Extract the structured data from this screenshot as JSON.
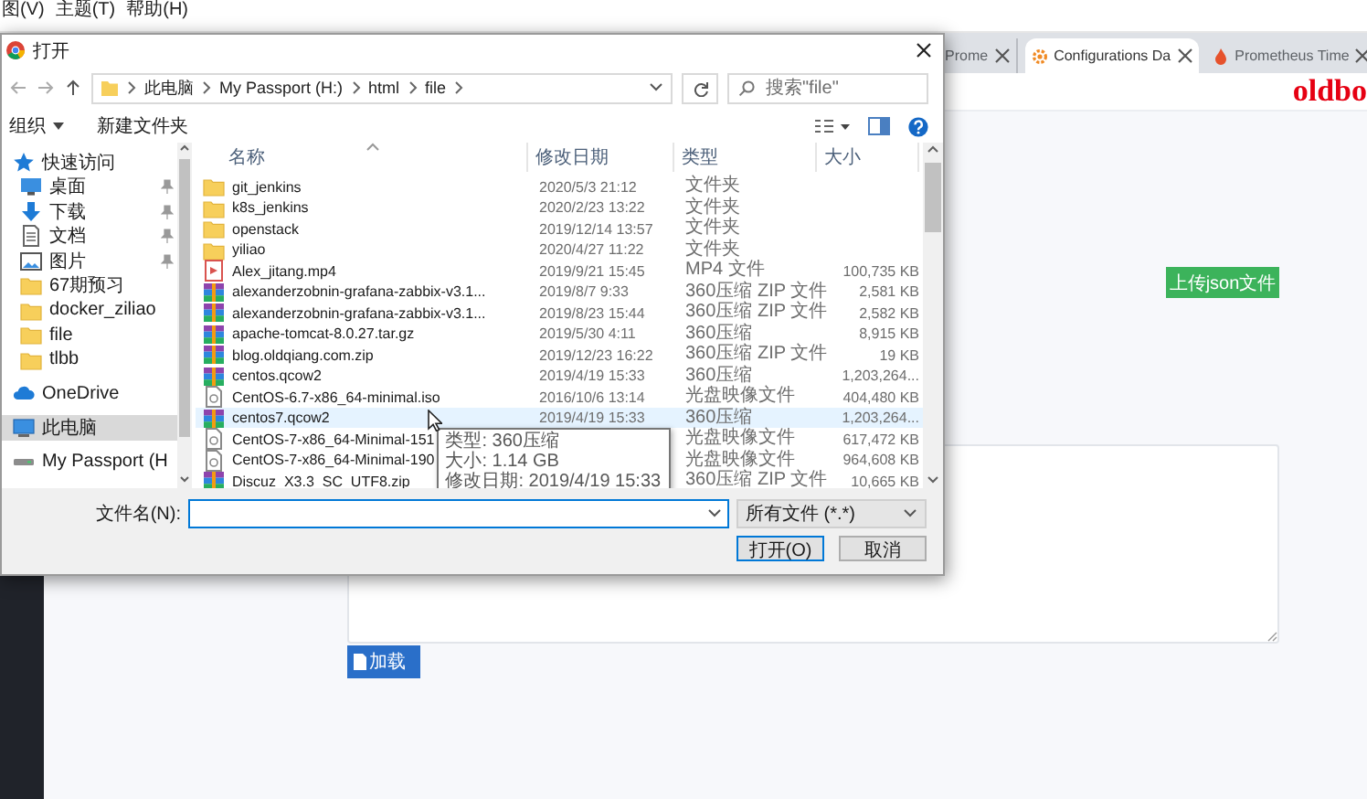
{
  "menu_bar": {
    "items": [
      "图(V)",
      "主题(T)",
      "帮助(H)"
    ]
  },
  "browser_tabs": [
    {
      "label": "Prome",
      "kind": "plain",
      "selected": false
    },
    {
      "label": "Configurations Da",
      "kind": "gear",
      "selected": true
    },
    {
      "label": "Prometheus Time",
      "kind": "flame",
      "selected": false
    }
  ],
  "page": {
    "brand": "oldbo",
    "upload_button": "上传json文件",
    "load_button": "加载"
  },
  "dialog": {
    "title": "打开",
    "breadcrumb": [
      "此电脑",
      "My Passport (H:)",
      "html",
      "file"
    ],
    "search": {
      "placeholder": "搜索\"file\""
    },
    "toolbar": {
      "organize": "组织",
      "new_folder": "新建文件夹"
    },
    "nav": [
      {
        "label": "快速访问",
        "kind": "star",
        "selected": false,
        "children": [
          {
            "label": "桌面",
            "kind": "desktop",
            "pinned": true,
            "selected": false
          },
          {
            "label": "下载",
            "kind": "download",
            "pinned": true,
            "selected": false
          },
          {
            "label": "文档",
            "kind": "document",
            "pinned": true,
            "selected": false
          },
          {
            "label": "图片",
            "kind": "picture",
            "pinned": true,
            "selected": false
          },
          {
            "label": "67期预习",
            "kind": "folder",
            "pinned": false,
            "selected": false
          },
          {
            "label": "docker_ziliao",
            "kind": "folder",
            "pinned": false,
            "selected": false
          },
          {
            "label": "file",
            "kind": "folder",
            "pinned": false,
            "selected": false
          },
          {
            "label": "tlbb",
            "kind": "folder",
            "pinned": false,
            "selected": false
          }
        ]
      },
      {
        "label": "OneDrive",
        "kind": "cloud",
        "selected": false
      },
      {
        "label": "此电脑",
        "kind": "computer",
        "selected": true
      },
      {
        "label": "My Passport (H",
        "kind": "drive",
        "selected": false
      }
    ],
    "columns": [
      "名称",
      "修改日期",
      "类型",
      "大小"
    ],
    "files": [
      {
        "name": "git_jenkins",
        "kind": "folder",
        "date": "2020/5/3 21:12",
        "type": "文件夹",
        "selected": false
      },
      {
        "name": "k8s_jenkins",
        "kind": "folder",
        "date": "2020/2/23 13:22",
        "type": "文件夹",
        "selected": false
      },
      {
        "name": "openstack",
        "kind": "folder",
        "date": "2019/12/14 13:57",
        "type": "文件夹",
        "selected": false
      },
      {
        "name": "yiliao",
        "kind": "folder",
        "date": "2020/4/27 11:22",
        "type": "文件夹",
        "selected": false
      },
      {
        "name": "Alex_jitang.mp4",
        "kind": "video",
        "date": "2019/9/21 15:45",
        "type": "MP4 文件",
        "size": "100,735 KB",
        "selected": false
      },
      {
        "name": "alexanderzobnin-grafana-zabbix-v3.1...",
        "kind": "archive",
        "date": "2019/8/7 9:33",
        "type": "360压缩 ZIP 文件",
        "size": "2,581 KB",
        "selected": false
      },
      {
        "name": "alexanderzobnin-grafana-zabbix-v3.1...",
        "kind": "archive",
        "date": "2019/8/23 15:44",
        "type": "360压缩 ZIP 文件",
        "size": "2,582 KB",
        "selected": false
      },
      {
        "name": "apache-tomcat-8.0.27.tar.gz",
        "kind": "archive",
        "date": "2019/5/30 4:11",
        "type": "360压缩",
        "size": "8,915 KB",
        "selected": false
      },
      {
        "name": "blog.oldqiang.com.zip",
        "kind": "archive",
        "date": "2019/12/23 16:22",
        "type": "360压缩 ZIP 文件",
        "size": "19 KB",
        "selected": false
      },
      {
        "name": "centos.qcow2",
        "kind": "archive",
        "date": "2019/4/19 15:33",
        "type": "360压缩",
        "size": "1,203,264...",
        "selected": false
      },
      {
        "name": "CentOS-6.7-x86_64-minimal.iso",
        "kind": "disc",
        "date": "2016/10/6 13:14",
        "type": "光盘映像文件",
        "size": "404,480 KB",
        "selected": false
      },
      {
        "name": "centos7.qcow2",
        "kind": "archive",
        "date": "2019/4/19 15:33",
        "type": "360压缩",
        "size": "1,203,264...",
        "selected": true
      },
      {
        "name": "CentOS-7-x86_64-Minimal-151",
        "kind": "disc",
        "type": "光盘映像文件",
        "size": "617,472 KB",
        "selected": false
      },
      {
        "name": "CentOS-7-x86_64-Minimal-190",
        "kind": "disc",
        "type": "光盘映像文件",
        "size": "964,608 KB",
        "selected": false
      },
      {
        "name": "Discuz_X3.3_SC_UTF8.zip",
        "kind": "archive",
        "type": "360压缩 ZIP 文件",
        "size": "10,665 KB",
        "selected": false
      }
    ],
    "tooltip": [
      "类型: 360压缩",
      "大小: 1.14 GB",
      "修改日期: 2019/4/19 15:33"
    ],
    "filename_label": "文件名(N):",
    "file_type": "所有文件 (*.*)",
    "open_button": "打开(O)",
    "cancel_button": "取消"
  }
}
